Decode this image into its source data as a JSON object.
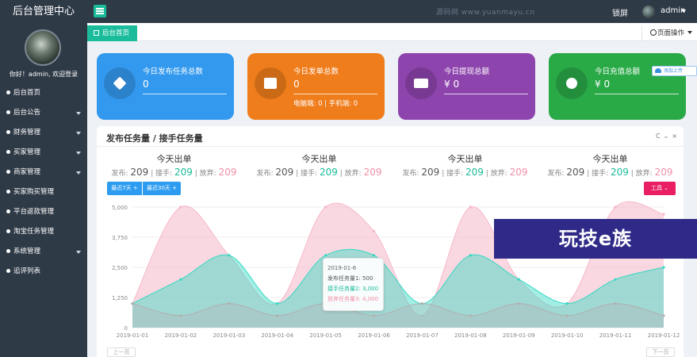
{
  "app": {
    "title": "后台管理中心"
  },
  "topbar": {
    "watermark": "源码网 www.yuanmayu.cn",
    "lock": "锁屏",
    "user": "admin"
  },
  "sidebar": {
    "welcome": "你好！admin, 欢迎登录",
    "items": [
      {
        "label": "后台首页",
        "has_arrow": false
      },
      {
        "label": "后台公告",
        "has_arrow": true
      },
      {
        "label": "财务管理",
        "has_arrow": true
      },
      {
        "label": "买家管理",
        "has_arrow": true
      },
      {
        "label": "商家管理",
        "has_arrow": true
      },
      {
        "label": "买家购买管理",
        "has_arrow": false
      },
      {
        "label": "平台返款管理",
        "has_arrow": false
      },
      {
        "label": "淘宝任务管理",
        "has_arrow": false
      },
      {
        "label": "系统管理",
        "has_arrow": true
      },
      {
        "label": "追评列表",
        "has_arrow": false
      }
    ]
  },
  "tabs": {
    "home": "后台首页",
    "page_ops": "页面操作"
  },
  "cards": [
    {
      "title": "今日发布任务总数",
      "value": "0",
      "sub": "",
      "color": "#3399ef",
      "icon": "tag-icon"
    },
    {
      "title": "今日发单总数",
      "value": "0",
      "sub": "电脑端: 0 | 手机端: 0",
      "color": "#ef7d1b",
      "icon": "briefcase-icon"
    },
    {
      "title": "今日提现总额",
      "value": "¥ 0",
      "sub": "",
      "color": "#8e44ad",
      "icon": "money-icon"
    },
    {
      "title": "今日充值总额",
      "value": "¥ 0",
      "sub": "",
      "color": "#2aa947",
      "icon": "dollar-icon"
    }
  ],
  "upload": {
    "label": "添加上传"
  },
  "panel": {
    "title": "发布任务量 / 接手任务量",
    "tools": [
      "C",
      "⌄",
      "×"
    ],
    "stats": [
      {
        "title": "今天出单",
        "l1": "发布:",
        "v1": "209",
        "l2": "| 接手:",
        "v2": "209",
        "l3": "| 放弃:",
        "v3": "209"
      },
      {
        "title": "今天出单",
        "l1": "发布:",
        "v1": "209",
        "l2": "| 接手:",
        "v2": "209",
        "l3": "| 放弃:",
        "v3": "209"
      },
      {
        "title": "今天出单",
        "l1": "发布:",
        "v1": "209",
        "l2": "| 接手:",
        "v2": "209",
        "l3": "| 放弃:",
        "v3": "209"
      },
      {
        "title": "今天出单",
        "l1": "发布:",
        "v1": "209",
        "l2": "| 接手:",
        "v2": "209",
        "l3": "| 放弃:",
        "v3": "209"
      }
    ],
    "btn_7": "最近7天 +",
    "btn_30": "最近30天 +",
    "btn_tools": "工具 ⌄",
    "prev": "上一页",
    "next": "下一页"
  },
  "tooltip": {
    "date": "2019-01-6",
    "l1": "发布任务量1: 500",
    "l2": "接手任务量2: 3,000",
    "l3": "放弃任务量3: 4,000"
  },
  "banner": {
    "text": "玩技e族"
  },
  "chart_data": {
    "type": "area",
    "x": [
      "2019-01-01",
      "2019-01-02",
      "2019-01-03",
      "2019-01-04",
      "2019-01-05",
      "2019-01-06",
      "2019-01-07",
      "2019-01-08",
      "2019-01-09",
      "2019-01-10",
      "2019-01-11",
      "2019-01-12"
    ],
    "yticks": [
      "5,000",
      "3,750",
      "2,500",
      "1,250",
      "0"
    ],
    "ylim": [
      0,
      5000
    ],
    "series": [
      {
        "name": "发布任务量1",
        "values": [
          1000,
          500,
          1000,
          500,
          1000,
          500,
          1000,
          500,
          1000,
          500,
          1000,
          500
        ],
        "color": "#b0b0b0"
      },
      {
        "name": "接手任务量2",
        "values": [
          1000,
          2000,
          3000,
          1000,
          3000,
          3000,
          1000,
          3000,
          2000,
          1000,
          2000,
          2500
        ],
        "color": "#34d9c4"
      },
      {
        "name": "放弃任务量3",
        "values": [
          1000,
          5000,
          3000,
          1000,
          5000,
          4000,
          500,
          5000,
          2000,
          1000,
          5000,
          4700
        ],
        "color": "#f6b8c8"
      }
    ],
    "grid": true
  }
}
